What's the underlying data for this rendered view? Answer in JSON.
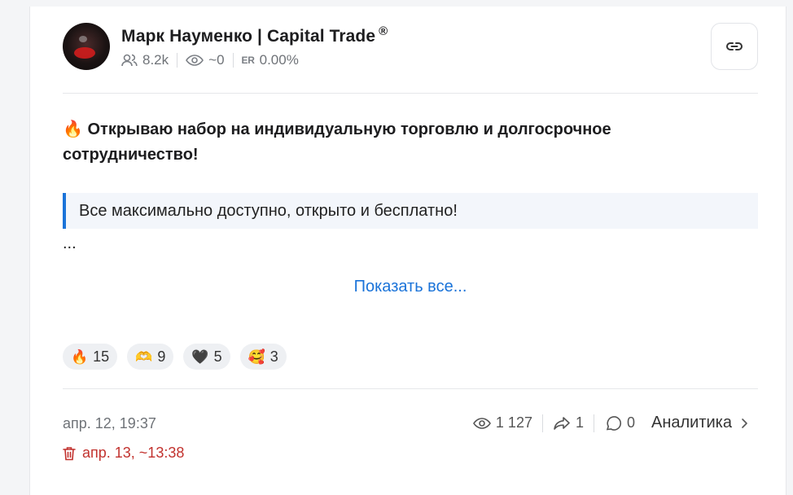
{
  "post": {
    "author": "Марк Науменко | Capital Trade",
    "author_badge": "®",
    "stats": {
      "subscribers": "8.2k",
      "views": "~0",
      "er_label": "ER",
      "er_value": "0.00%"
    },
    "headline_emoji": "🔥",
    "headline": "Открываю набор на индивидуальную торговлю и долгосрочное сотрудничество!",
    "quote": "Все максимально доступно, открыто и бесплатно!",
    "ellipsis": "...",
    "show_all": "Показать все...",
    "reactions": [
      {
        "emoji": "🔥",
        "count": "15"
      },
      {
        "emoji": "🫶",
        "count": "9"
      },
      {
        "emoji": "🖤",
        "count": "5"
      },
      {
        "emoji": "🥰",
        "count": "3"
      }
    ],
    "date": "апр. 12, 19:37",
    "deleted_date": "апр. 13, ~13:38",
    "footer": {
      "views": "1 127",
      "shares": "1",
      "comments": "0",
      "analytics": "Аналитика"
    }
  },
  "colors": {
    "accent": "#1a73d9",
    "danger": "#c2322e"
  }
}
